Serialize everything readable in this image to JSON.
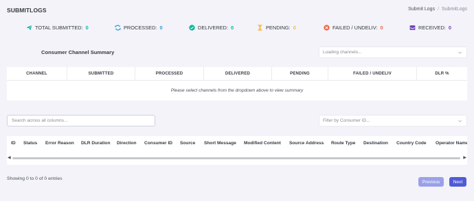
{
  "header": {
    "title": "SUBMITLOGS",
    "breadcrumb": [
      "Submit Logs",
      "SubmitLogs"
    ]
  },
  "stats": [
    {
      "label": "TOTAL SUBMITTED:",
      "value": "0",
      "icon": "paper-plane-icon",
      "color": "#0ab39c"
    },
    {
      "label": "PROCESSED:",
      "value": "0",
      "icon": "sync-icon",
      "color": "#299cdb"
    },
    {
      "label": "DELIVERED:",
      "value": "0",
      "icon": "check-circle-icon",
      "color": "#0ab39c"
    },
    {
      "label": "PENDING:",
      "value": "0",
      "icon": "hourglass-icon",
      "color": "#f7b84b"
    },
    {
      "label": "FAILED / UNDELIV:",
      "value": "0",
      "icon": "times-circle-icon",
      "color": "#f06548"
    },
    {
      "label": "RECEIVED:",
      "value": "0",
      "icon": "inbox-icon",
      "color": "#6f42c1"
    }
  ],
  "summary": {
    "title": "Consumer Channel Summary",
    "channel_select_placeholder": "Loading channels...",
    "columns": [
      "CHANNEL",
      "SUBMITTED",
      "PROCESSED",
      "DELIVERED",
      "PENDING",
      "FAILED / UNDELIV",
      "DLR %"
    ],
    "empty_message": "Please select channels from the dropdown above to view summary"
  },
  "filters": {
    "search_placeholder": "Search across all columns...",
    "consumer_placeholder": "Filter by Consumer ID..."
  },
  "logs": {
    "columns": [
      "ID",
      "Status",
      "Error Reason",
      "DLR Duration",
      "Direction",
      "Consumer ID",
      "Source",
      "Short Message",
      "Modified Content",
      "Source Address",
      "Route Type",
      "Destination",
      "Country Code",
      "Operator Name"
    ]
  },
  "footer": {
    "entries_text": "Showing 0 to 0 of 0 entries",
    "prev_label": "Previous",
    "next_label": "Next"
  }
}
